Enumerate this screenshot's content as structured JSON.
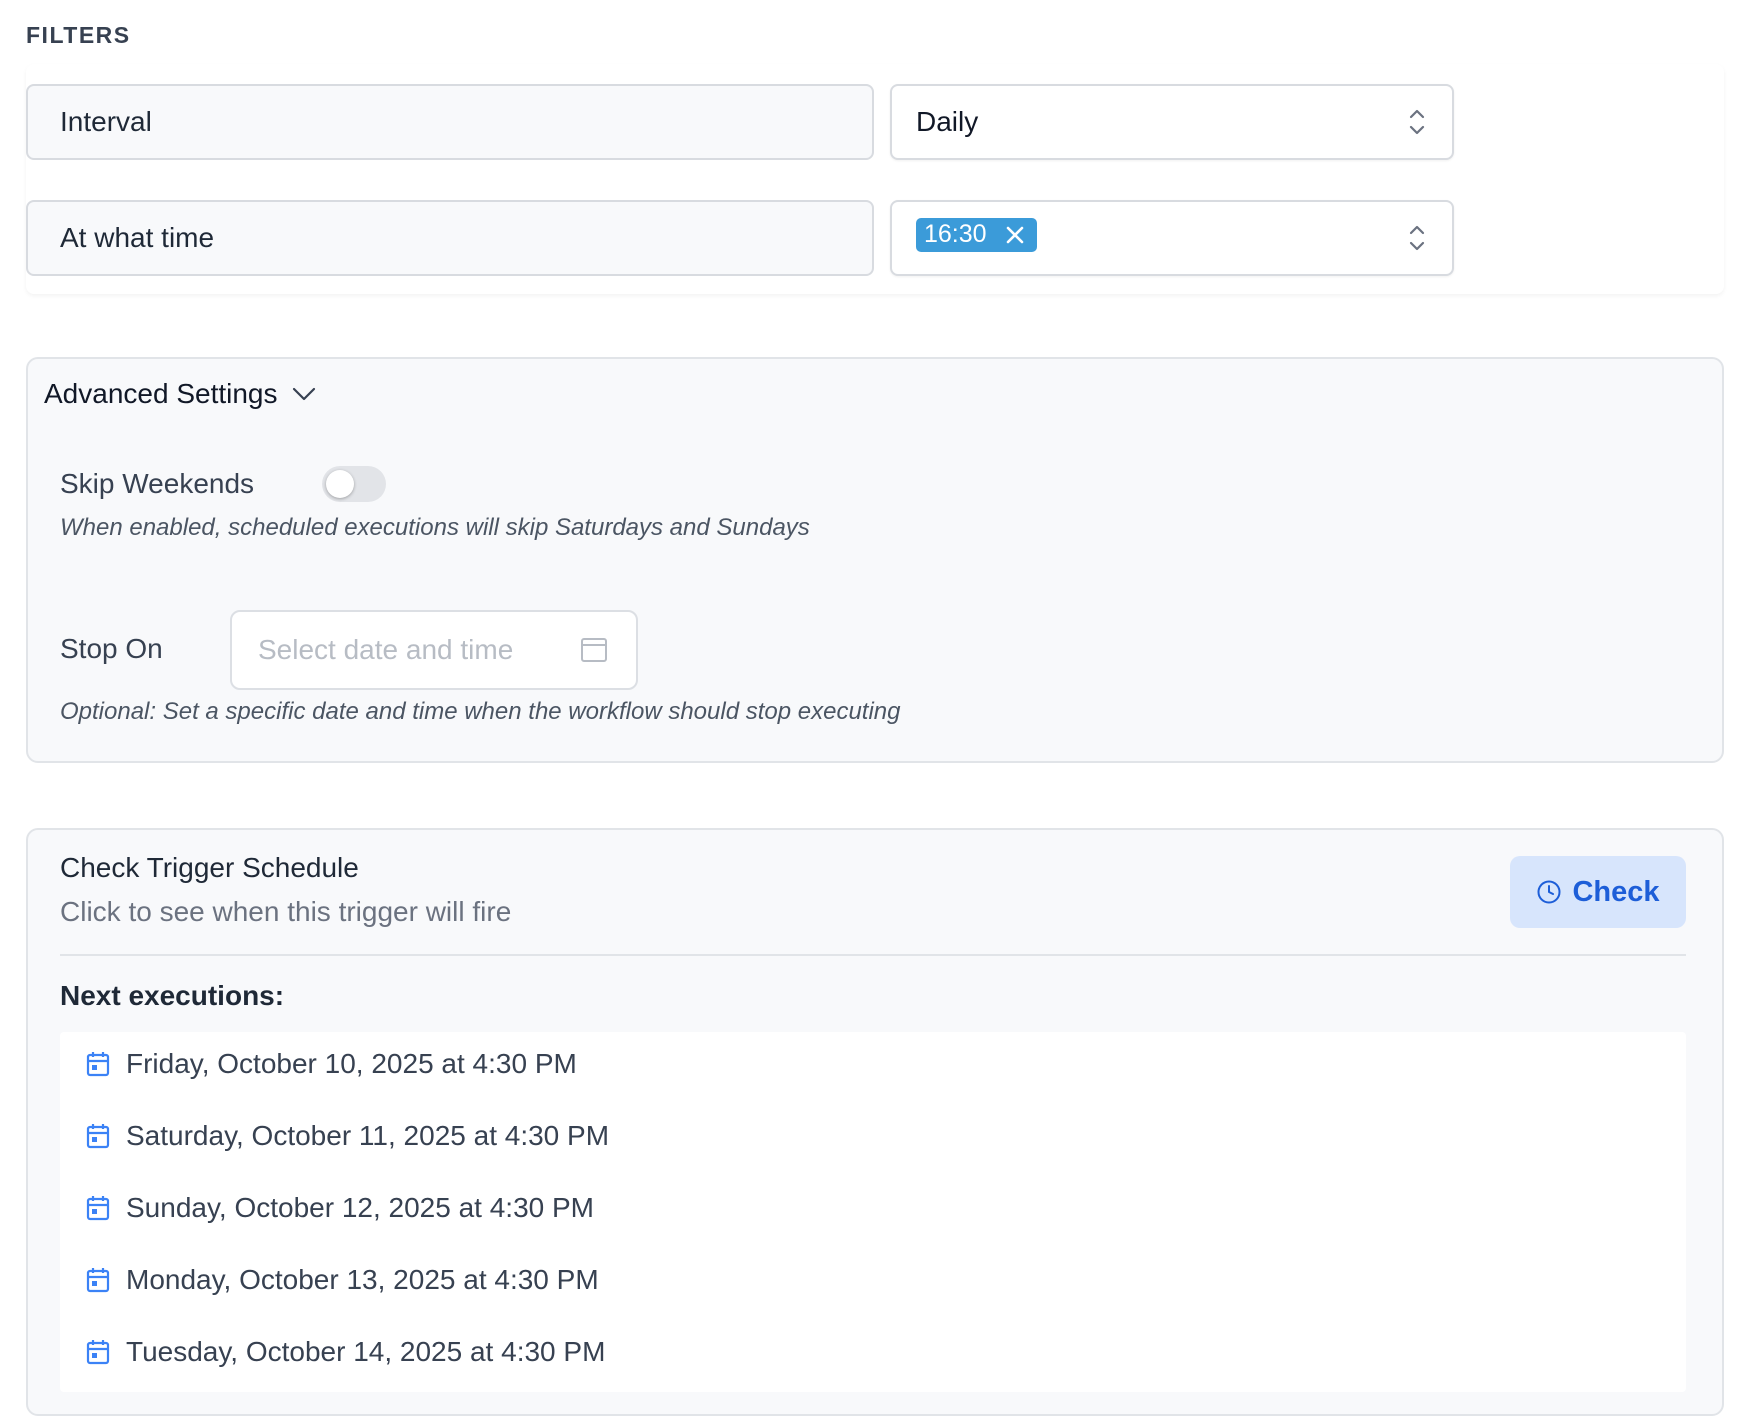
{
  "filters": {
    "title": "FILTERS",
    "interval": {
      "label": "Interval",
      "value": "Daily"
    },
    "time": {
      "label": "At what time",
      "chip": "16:30"
    }
  },
  "advanced": {
    "title": "Advanced Settings",
    "skip_weekends": {
      "label": "Skip Weekends",
      "enabled": false,
      "help": "When enabled, scheduled executions will skip Saturdays and Sundays"
    },
    "stop_on": {
      "label": "Stop On",
      "placeholder": "Select date and time",
      "help": "Optional: Set a specific date and time when the workflow should stop executing"
    }
  },
  "check": {
    "title": "Check Trigger Schedule",
    "subtitle": "Click to see when this trigger will fire",
    "button_label": "Check",
    "next_title": "Next executions:",
    "executions": [
      "Friday, October 10, 2025 at 4:30 PM",
      "Saturday, October 11, 2025 at 4:30 PM",
      "Sunday, October 12, 2025 at 4:30 PM",
      "Monday, October 13, 2025 at 4:30 PM",
      "Tuesday, October 14, 2025 at 4:30 PM"
    ]
  },
  "colors": {
    "chip": "#3b9bd9",
    "accent": "#1d5ed8",
    "check_button_bg": "#d7e5fc"
  }
}
